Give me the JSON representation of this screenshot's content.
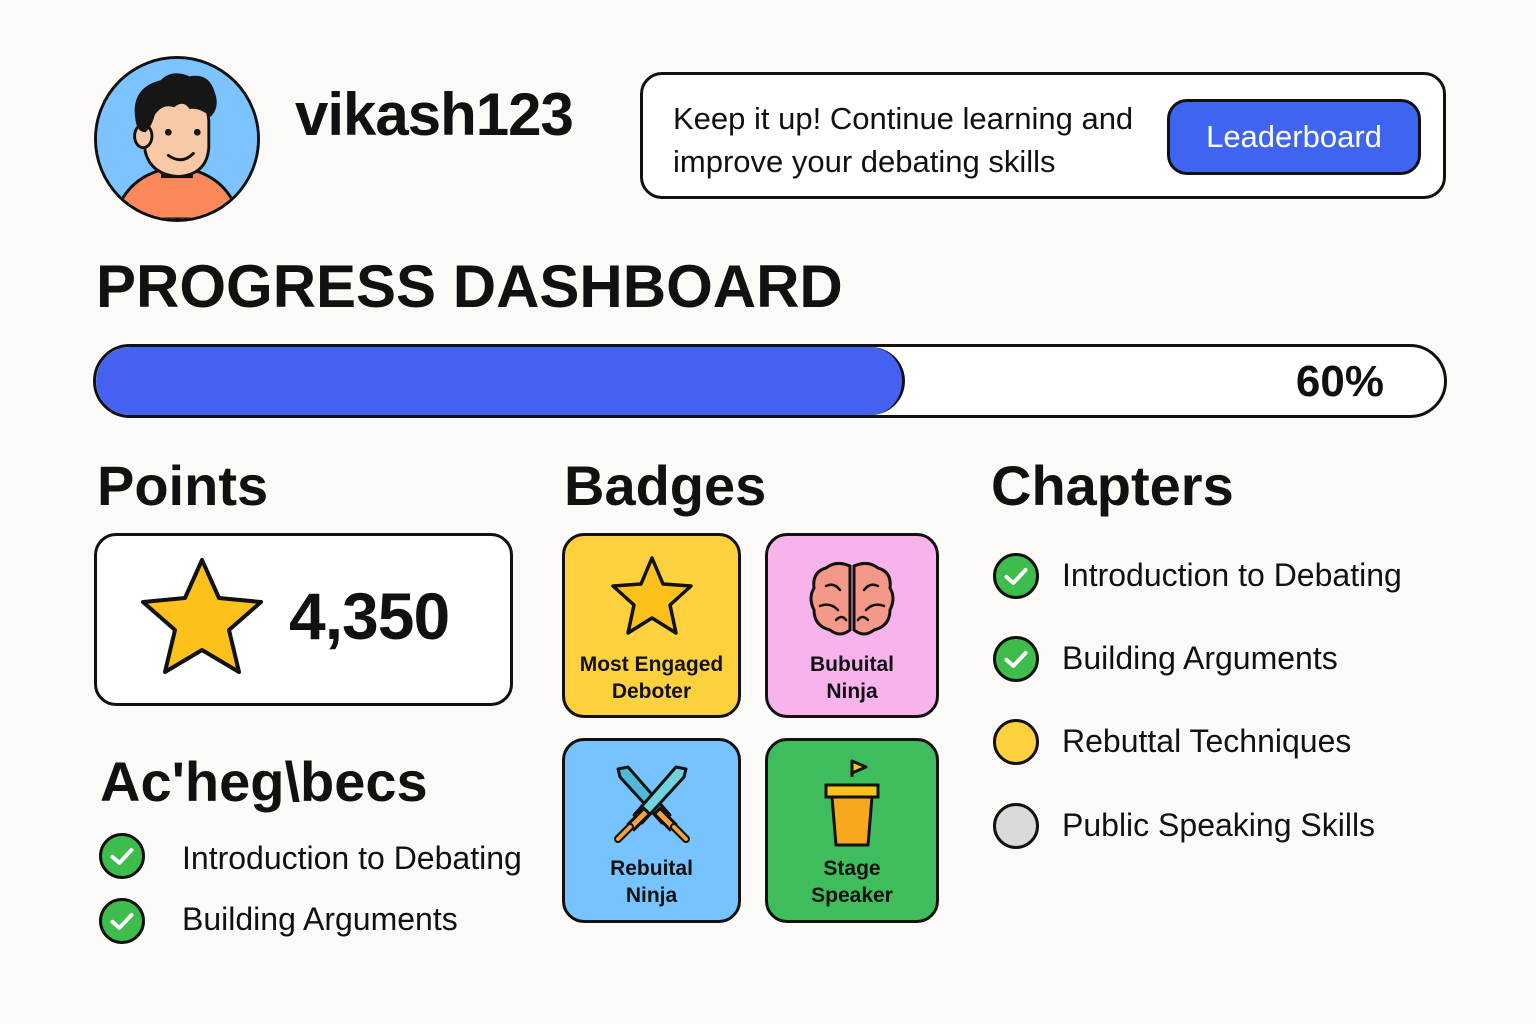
{
  "profile": {
    "username": "vikash123"
  },
  "motivation": {
    "message": "Keep it up! Continue learning and improve your debating skills",
    "button_label": "Leaderboard"
  },
  "dashboard": {
    "title": "PROGRESS DASHBOARD",
    "progress_percent": 60,
    "progress_label": "60%"
  },
  "points": {
    "heading": "Points",
    "value": "4,350"
  },
  "badges": {
    "heading": "Badges",
    "items": [
      {
        "line1": "Most Engaged",
        "line2": "Deboter",
        "icon": "star-icon",
        "color": "#fdd13e"
      },
      {
        "line1": "Bubuital",
        "line2": "Ninja",
        "icon": "brain-icon",
        "color": "#f9b3ec"
      },
      {
        "line1": "Rebuital",
        "line2": "Ninja",
        "icon": "crossed-swords-icon",
        "color": "#77c3fd"
      },
      {
        "line1": "Stage",
        "line2": "Speaker",
        "icon": "podium-icon",
        "color": "#3fbd5c"
      }
    ]
  },
  "achievements": {
    "heading": "Ac'heg\\becs",
    "items": [
      {
        "label": "Introduction to Debating",
        "status": "complete"
      },
      {
        "label": "Building Arguments",
        "status": "complete"
      }
    ]
  },
  "chapters": {
    "heading": "Chapters",
    "items": [
      {
        "label": "Introduction to Debating",
        "status": "complete"
      },
      {
        "label": "Building Arguments",
        "status": "complete"
      },
      {
        "label": "Rebuttal Techniques",
        "status": "in-progress"
      },
      {
        "label": "Public Speaking Skills",
        "status": "not-started"
      }
    ]
  },
  "colors": {
    "accent": "#4461f2",
    "complete": "#3fbd4c",
    "in_progress": "#fdd13e",
    "not_started": "#d9d9d9"
  }
}
